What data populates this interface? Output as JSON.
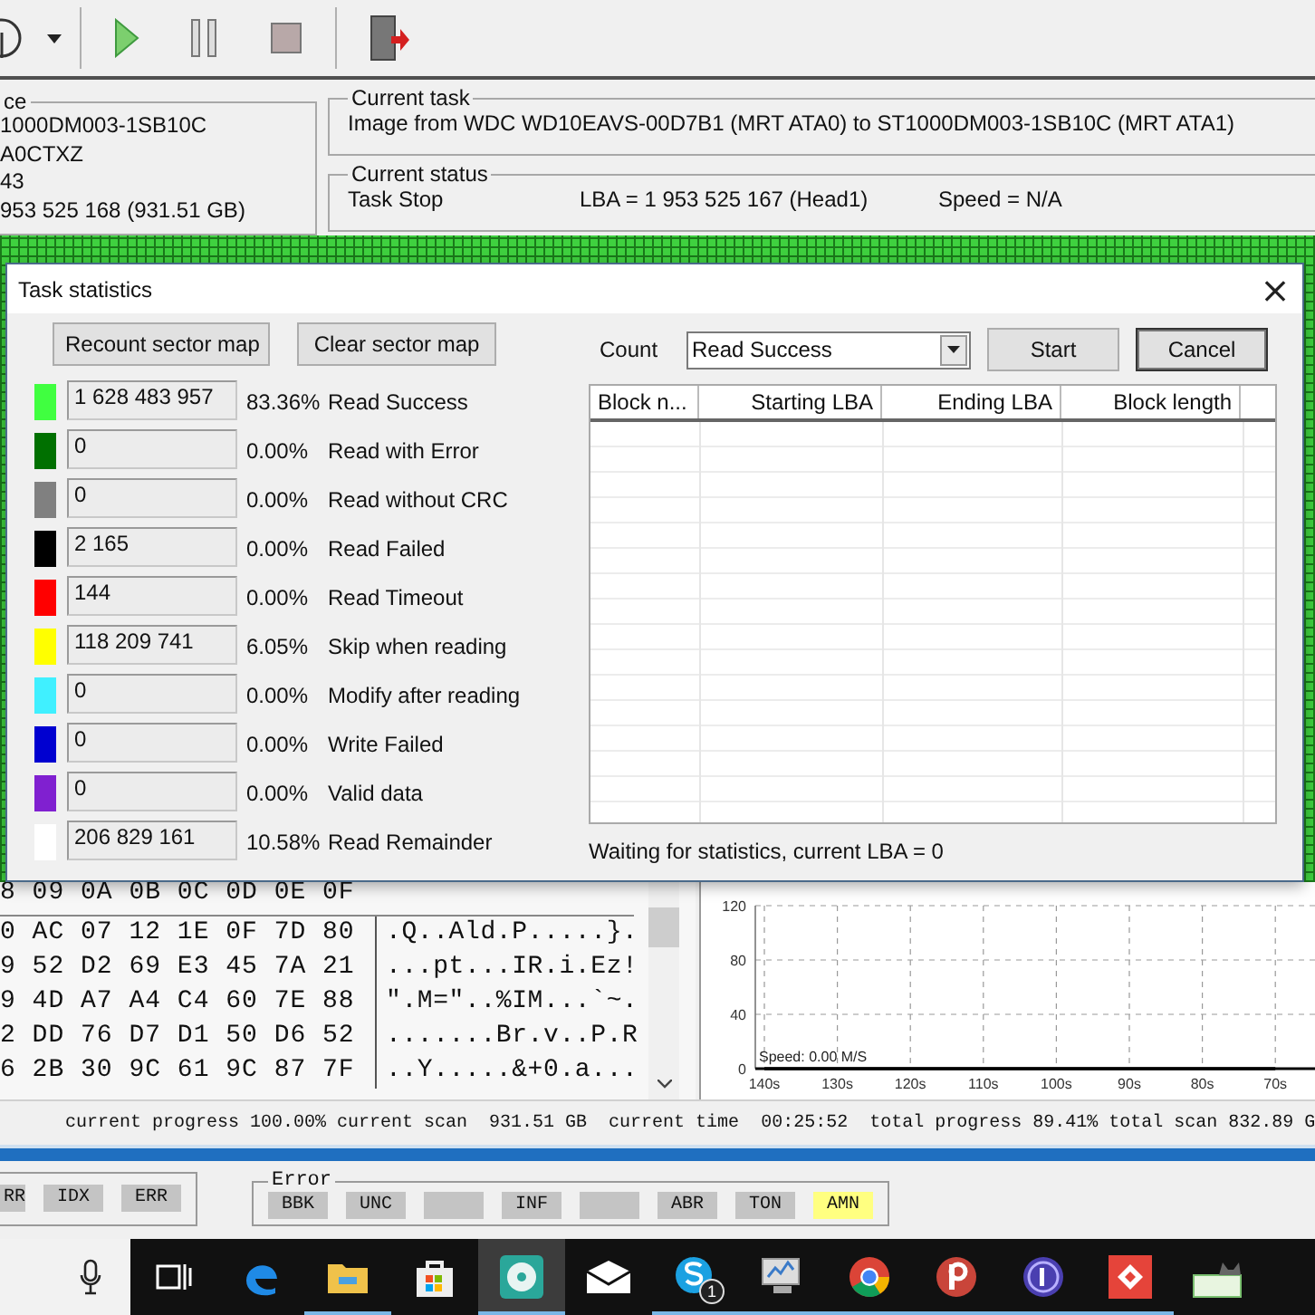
{
  "device_panel": {
    "legend": "ce",
    "lines": [
      "1000DM003-1SB10C",
      "A0CTXZ",
      "43",
      "953 525 168 (931.51 GB)"
    ]
  },
  "current_task": {
    "legend": "Current task",
    "text": "Image from WDC WD10EAVS-00D7B1 (MRT ATA0) to ST1000DM003-1SB10C (MRT ATA1)"
  },
  "current_status": {
    "legend": "Current status",
    "state": "Task Stop",
    "lba": "LBA = 1 953 525 167 (Head1)",
    "speed": "Speed = N/A"
  },
  "dialog": {
    "title": "Task statistics",
    "close": "×",
    "buttons": [
      "Recount sector map",
      "Clear sector map"
    ],
    "stats": [
      {
        "color": "#40ff40",
        "count": "1 628 483 957",
        "percent": "83.36%",
        "label": "Read Success"
      },
      {
        "color": "#007000",
        "count": "0",
        "percent": "0.00%",
        "label": "Read with Error"
      },
      {
        "color": "#808080",
        "count": "0",
        "percent": "0.00%",
        "label": "Read without CRC"
      },
      {
        "color": "#000000",
        "count": "2 165",
        "percent": "0.00%",
        "label": "Read Failed"
      },
      {
        "color": "#ff0000",
        "count": "144",
        "percent": "0.00%",
        "label": "Read Timeout"
      },
      {
        "color": "#ffff00",
        "count": "118 209 741",
        "percent": "6.05%",
        "label": "Skip when reading"
      },
      {
        "color": "#40f0ff",
        "count": "0",
        "percent": "0.00%",
        "label": "Modify after reading"
      },
      {
        "color": "#0000d0",
        "count": "0",
        "percent": "0.00%",
        "label": "Write Failed"
      },
      {
        "color": "#8020d0",
        "count": "0",
        "percent": "0.00%",
        "label": "Valid data"
      },
      {
        "color": "#ffffff",
        "count": "206 829 161",
        "percent": "10.58%",
        "label": "Read Remainder"
      }
    ],
    "count_label": "Count",
    "count_select": "Read Success",
    "actions": [
      {
        "label": "Start",
        "default": false
      },
      {
        "label": "Cancel",
        "default": true
      }
    ],
    "table": {
      "columns": [
        "Block n...",
        "Starting LBA",
        "Ending LBA",
        "Block length"
      ]
    },
    "status": "Waiting for statistics, current LBA = 0"
  },
  "hex": {
    "header": "8 09 0A 0B 0C 0D 0E 0F",
    "rows": [
      {
        "hex": "0 AC 07 12 1E 0F 7D 80",
        "ascii": ".Q..Ald.P.....}."
      },
      {
        "hex": "9 52 D2 69 E3 45 7A 21",
        "ascii": "...pt...IR.i.Ez!"
      },
      {
        "hex": "9 4D A7 A4 C4 60 7E 88",
        "ascii": "\".M=\"..%IM...`~."
      },
      {
        "hex": "2 DD 76 D7 D1 50 D6 52",
        "ascii": ".......Br.v..P.R"
      },
      {
        "hex": "6 2B 30 9C 61 9C 87 7F",
        "ascii": "..Y.....&+0.a..."
      }
    ]
  },
  "speed_chart": {
    "chart_data": {
      "type": "line",
      "categories": [
        "140s",
        "130s",
        "120s",
        "110s",
        "100s",
        "90s",
        "80s",
        "70s"
      ],
      "series": [
        {
          "color": "#000000",
          "values": [
            0,
            0,
            0,
            0,
            0,
            0,
            0,
            0
          ]
        }
      ],
      "ylim": [
        0,
        120
      ],
      "yticks": [
        0,
        40,
        80,
        120
      ],
      "grid": true,
      "annotations": [
        "Speed: 0.00 M/S"
      ]
    }
  },
  "progress_bar": {
    "level": 1
  },
  "status_line": "current progress 100.00% current scan  931.51 GB  current time  00:25:52  total progress 89.41% total scan 832.89 G",
  "flags_left": [
    {
      "label": "RR",
      "on": false
    },
    {
      "label": "IDX",
      "on": false
    },
    {
      "label": "ERR",
      "on": false
    }
  ],
  "error_group": {
    "legend": "Error",
    "flags": [
      {
        "label": "BBK",
        "on": false
      },
      {
        "label": "UNC",
        "on": false
      },
      {
        "on": false
      },
      {
        "label": "INF",
        "on": false
      },
      {
        "on": false
      },
      {
        "label": "ABR",
        "on": false
      },
      {
        "label": "TON",
        "on": false
      },
      {
        "label": "AMN",
        "on": true
      }
    ]
  },
  "taskbar": {
    "apps": [
      {
        "kind": "task-view",
        "running": false,
        "active": false
      },
      {
        "kind": "edge",
        "running": false,
        "active": false
      },
      {
        "kind": "folder",
        "running": true,
        "active": false
      },
      {
        "kind": "store",
        "running": false,
        "active": false
      },
      {
        "kind": "disk-app",
        "running": true,
        "active": true
      },
      {
        "kind": "mail",
        "running": false,
        "active": false
      },
      {
        "kind": "skype",
        "running": true,
        "active": false,
        "badge": "1"
      },
      {
        "kind": "monitor",
        "running": true,
        "active": false
      },
      {
        "kind": "chrome",
        "running": true,
        "active": false
      },
      {
        "kind": "p-app",
        "running": true,
        "active": false
      },
      {
        "kind": "p-purple",
        "running": true,
        "active": false
      },
      {
        "kind": "red-app",
        "running": true,
        "active": false
      },
      {
        "kind": "tray-app",
        "running": false,
        "active": false
      }
    ]
  }
}
